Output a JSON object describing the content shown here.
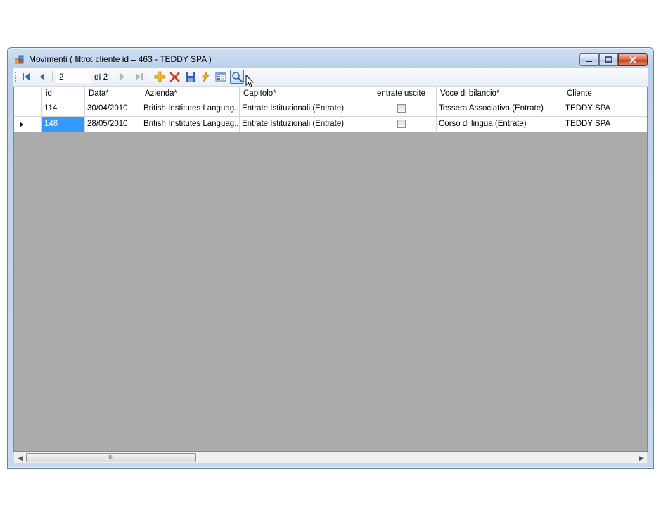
{
  "window": {
    "title": "Movimenti ( filtro: cliente id = 463 - TEDDY SPA  )"
  },
  "toolbar": {
    "position_value": "2",
    "of_label": "di 2",
    "buttons": [
      "move-first-icon",
      "move-previous-icon",
      "move-next-icon",
      "move-last-icon",
      "add-icon",
      "delete-icon",
      "save-icon",
      "lightning-icon",
      "form-view-icon",
      "search-icon"
    ]
  },
  "grid": {
    "columns": [
      "id",
      "Data*",
      "Azienda*",
      "Capitolo*",
      "entrate uscite",
      "Voce di bilancio*",
      "Cliente"
    ],
    "rows": [
      {
        "id": "114",
        "data": "30/04/2010",
        "azienda": "British Institutes Languag...",
        "capitolo": "Entrate Istituzionali (Entrate)",
        "entrate_uscite": false,
        "voce": "Tessera Associativa (Entrate)",
        "cliente": "TEDDY SPA"
      },
      {
        "id": "148",
        "data": "28/05/2010",
        "azienda": "British Institutes Languag...",
        "capitolo": "Entrate Istituzionali (Entrate)",
        "entrate_uscite": false,
        "voce": "Corso di lingua (Entrate)",
        "cliente": "TEDDY SPA"
      }
    ],
    "current_row": 1
  },
  "scrollbar": {
    "thumb_grip": "III"
  }
}
